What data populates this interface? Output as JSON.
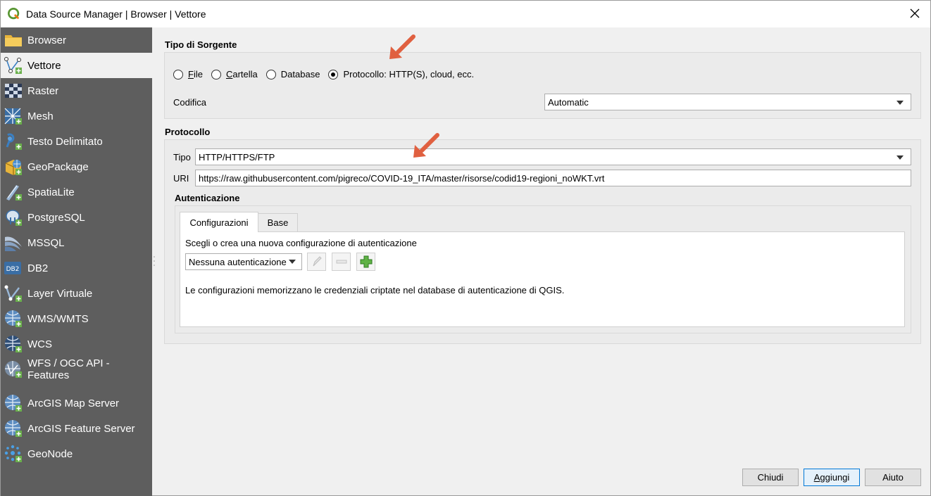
{
  "window": {
    "title": "Data Source Manager | Browser | Vettore"
  },
  "sidebar": {
    "items": [
      {
        "label": "Browser",
        "icon": "folder-icon"
      },
      {
        "label": "Vettore",
        "icon": "vector-icon"
      },
      {
        "label": "Raster",
        "icon": "raster-icon"
      },
      {
        "label": "Mesh",
        "icon": "mesh-icon"
      },
      {
        "label": "Testo Delimitato",
        "icon": "delimited-text-icon"
      },
      {
        "label": "GeoPackage",
        "icon": "geopackage-icon"
      },
      {
        "label": "SpatiaLite",
        "icon": "spatialite-icon"
      },
      {
        "label": "PostgreSQL",
        "icon": "postgresql-icon"
      },
      {
        "label": "MSSQL",
        "icon": "mssql-icon"
      },
      {
        "label": "DB2",
        "icon": "db2-icon"
      },
      {
        "label": "Layer Virtuale",
        "icon": "virtual-layer-icon"
      },
      {
        "label": "WMS/WMTS",
        "icon": "wms-icon"
      },
      {
        "label": "WCS",
        "icon": "wcs-icon"
      },
      {
        "label": "WFS / OGC API - Features",
        "icon": "wfs-icon"
      },
      {
        "label": "ArcGIS Map Server",
        "icon": "arcgis-map-icon"
      },
      {
        "label": "ArcGIS Feature Server",
        "icon": "arcgis-feature-icon"
      },
      {
        "label": "GeoNode",
        "icon": "geonode-icon"
      }
    ],
    "active_index": 1
  },
  "source_type": {
    "title": "Tipo di Sorgente",
    "options": [
      "File",
      "Cartella",
      "Database",
      "Protocollo: HTTP(S), cloud, ecc."
    ],
    "selected_index": 3,
    "encoding_label": "Codifica",
    "encoding_value": "Automatic"
  },
  "protocol": {
    "title": "Protocollo",
    "type_label": "Tipo",
    "type_value": "HTTP/HTTPS/FTP",
    "uri_label": "URI",
    "uri_value": "https://raw.githubusercontent.com/pigreco/COVID-19_ITA/master/risorse/codid19-regioni_noWKT.vrt"
  },
  "auth": {
    "title": "Autenticazione",
    "tabs": [
      "Configurazioni",
      "Base"
    ],
    "active_tab": 0,
    "prompt": "Scegli o crea una nuova configurazione di autenticazione",
    "config_value": "Nessuna autenticazione",
    "note": "Le configurazioni memorizzano le credenziali criptate nel database di autenticazione di QGIS."
  },
  "buttons": {
    "close": "Chiudi",
    "add": "Aggiungi",
    "help": "Aiuto"
  },
  "colors": {
    "sidebar_bg": "#5e5e5e",
    "annotation_arrow": "#e06040",
    "accent": "#0078d7"
  }
}
